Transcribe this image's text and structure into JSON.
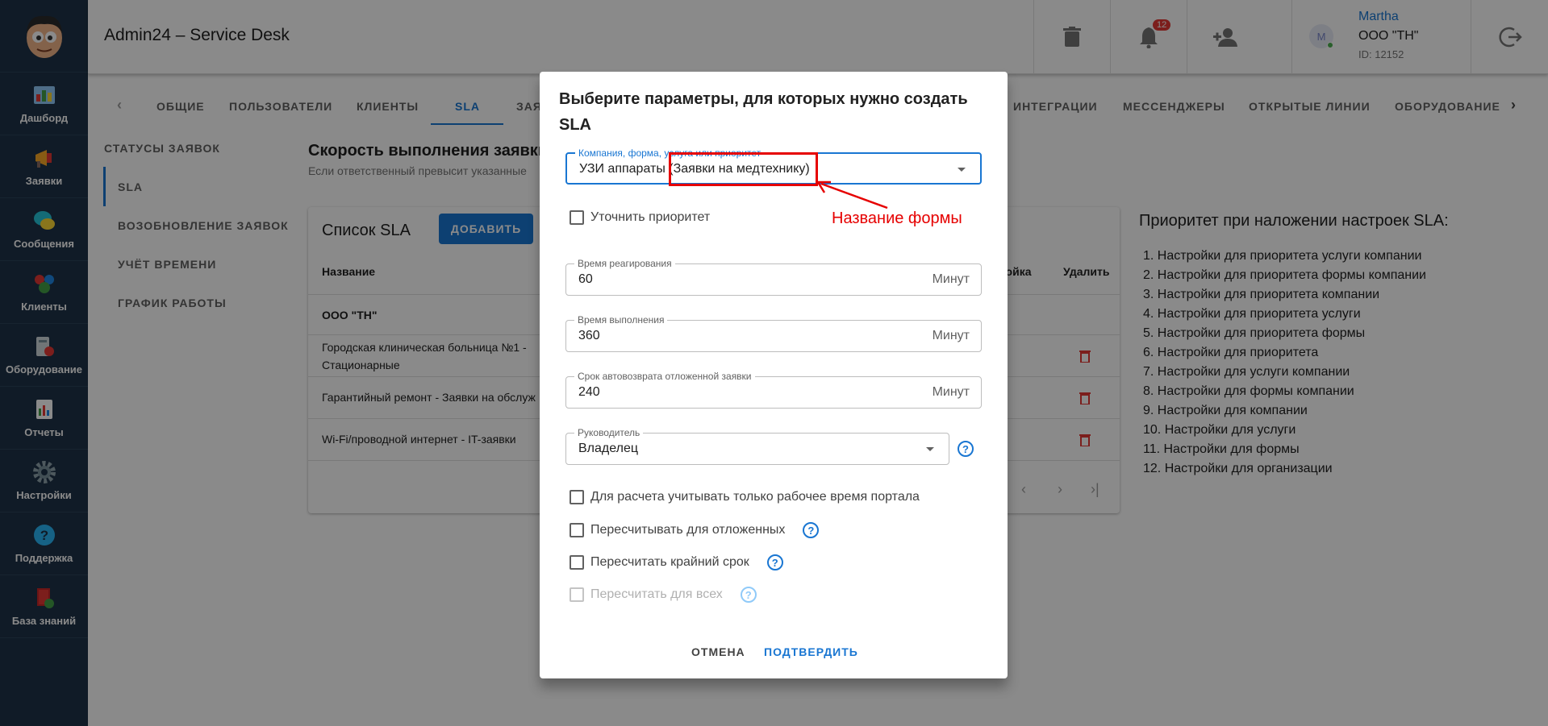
{
  "app": {
    "title": "Admin24 – Service Desk"
  },
  "sidebar": {
    "items": [
      {
        "label": "Дашборд",
        "icon": "dashboard-icon"
      },
      {
        "label": "Заявки",
        "icon": "megaphone-icon"
      },
      {
        "label": "Сообщения",
        "icon": "chat-icon"
      },
      {
        "label": "Клиенты",
        "icon": "clients-icon"
      },
      {
        "label": "Оборудование",
        "icon": "equipment-icon"
      },
      {
        "label": "Отчеты",
        "icon": "report-icon"
      },
      {
        "label": "Настройки",
        "icon": "gear-icon"
      },
      {
        "label": "Поддержка",
        "icon": "help-icon"
      },
      {
        "label": "База знаний",
        "icon": "book-icon"
      }
    ]
  },
  "header": {
    "notifications_count": "12",
    "user": {
      "name": "Martha",
      "org": "ООО \"ТН\"",
      "id": "ID: 12152",
      "avatar_letter": "M"
    }
  },
  "tabs": [
    "ОБЩИЕ",
    "ПОЛЬЗОВАТЕЛИ",
    "КЛИЕНТЫ",
    "SLA",
    "ЗАЯ",
    "ИНТЕГРАЦИИ",
    "МЕССЕНДЖЕРЫ",
    "ОТКРЫТЫЕ ЛИНИИ",
    "ОБОРУДОВАНИЕ"
  ],
  "settings_menu": [
    "СТАТУСЫ ЗАЯВОК",
    "SLA",
    "ВОЗОБНОВЛЕНИЕ ЗАЯВОК",
    "УЧЁТ ВРЕМЕНИ",
    "ГРАФИК РАБОТЫ"
  ],
  "main": {
    "section_title": "Скорость выполнения заявки",
    "section_sub": "Если ответственный превысит указанные",
    "card_title": "Список SLA",
    "add_button": "ДОБАВИТЬ",
    "columns": {
      "name": "Название",
      "settings": "ройка",
      "delete": "Удалить"
    },
    "rows": [
      {
        "name": "ООО \"ТН\""
      },
      {
        "name": "Городская клиническая больница №1 - Стационарные"
      },
      {
        "name": "Гарантийный ремонт - Заявки на обслуж"
      },
      {
        "name": "Wi-Fi/проводной интернет - IT-заявки"
      }
    ]
  },
  "priority": {
    "title": "Приоритет при наложении настроек SLA:",
    "items": [
      "1. Настройки для приоритета услуги компании",
      "2. Настройки для приоритета формы компании",
      "3. Настройки для приоритета компании",
      "4. Настройки для приоритета услуги",
      "5. Настройки для приоритета формы",
      "6. Настройки для приоритета",
      "7. Настройки для услуги компании",
      "8. Настройки для формы компании",
      "9. Настройки для компании",
      "10. Настройки для услуги",
      "11. Настройки для формы",
      "12. Настройки для организации"
    ]
  },
  "dialog": {
    "title": "Выберите параметры, для которых нужно создать SLA",
    "company_field": {
      "label": "Компания, форма, услуга или приоритет",
      "value": "УЗИ аппараты (Заявки на медтехнику)"
    },
    "specify_priority": "Уточнить приоритет",
    "reaction": {
      "label": "Время реагирования",
      "value": "60",
      "unit": "Минут"
    },
    "execution": {
      "label": "Время выполнения",
      "value": "360",
      "unit": "Минут"
    },
    "autoreturn": {
      "label": "Срок автовозврата отложенной заявки",
      "value": "240",
      "unit": "Минут"
    },
    "manager": {
      "label": "Руководитель",
      "value": "Владелец"
    },
    "checkboxes": [
      "Для расчета учитывать только рабочее время портала",
      "Пересчитывать для отложенных",
      "Пересчитать крайний срок",
      "Пересчитать для всех"
    ],
    "cancel": "ОТМЕНА",
    "confirm": "ПОДТВЕРДИТЬ"
  },
  "annotation": {
    "text": "Название формы"
  }
}
